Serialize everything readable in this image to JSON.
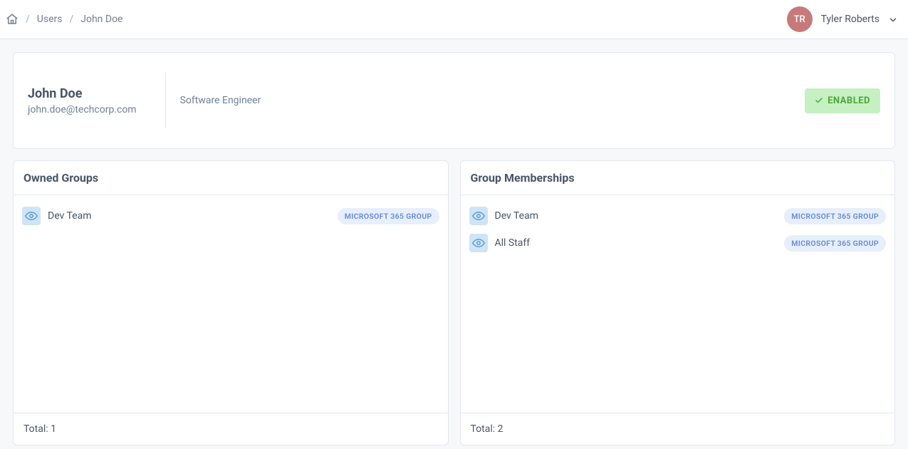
{
  "breadcrumb": {
    "home": "Home",
    "users": "Users",
    "current": "John Doe"
  },
  "current_user": {
    "initials": "TR",
    "name": "Tyler Roberts"
  },
  "profile": {
    "name": "John Doe",
    "email": "john.doe@techcorp.com",
    "role": "Software Engineer",
    "status": "ENABLED"
  },
  "owned_groups": {
    "title": "Owned Groups",
    "items": [
      {
        "name": "Dev Team",
        "type": "MICROSOFT 365 GROUP"
      }
    ],
    "total_label": "Total: 1"
  },
  "memberships": {
    "title": "Group Memberships",
    "items": [
      {
        "name": "Dev Team",
        "type": "MICROSOFT 365 GROUP"
      },
      {
        "name": "All Staff",
        "type": "MICROSOFT 365 GROUP"
      }
    ],
    "total_label": "Total: 2"
  }
}
